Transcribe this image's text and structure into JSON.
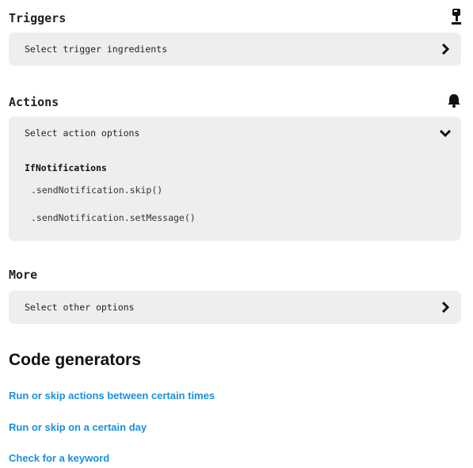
{
  "triggers": {
    "title": "Triggers",
    "icon": "trigger-icon",
    "select_label": "Select trigger ingredients",
    "chevron": "chevron-right-icon"
  },
  "actions": {
    "title": "Actions",
    "icon": "bell-icon",
    "select_label": "Select action options",
    "chevron": "chevron-down-icon",
    "group_title": "IfNotifications",
    "items": [
      ".sendNotification.skip()",
      ".sendNotification.setMessage()"
    ]
  },
  "more": {
    "title": "More",
    "select_label": "Select other options",
    "chevron": "chevron-right-icon"
  },
  "code_generators": {
    "title": "Code generators",
    "links": [
      "Run or skip actions between certain times",
      "Run or skip on a certain day",
      "Check for a keyword"
    ]
  },
  "colors": {
    "panel_bg": "#eeeeee",
    "link": "#1a8fe0"
  }
}
